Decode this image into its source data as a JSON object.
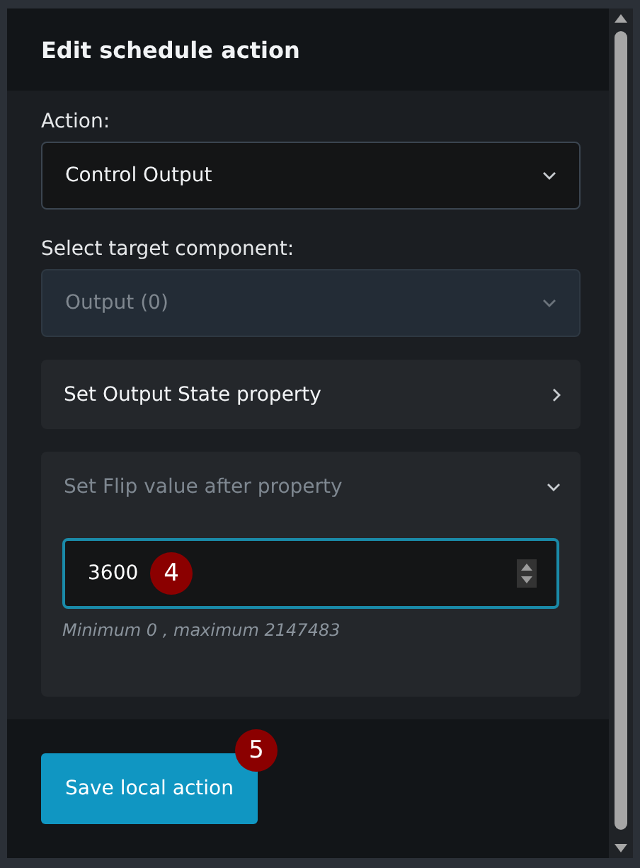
{
  "dialog": {
    "title": "Edit schedule action"
  },
  "fields": [
    {
      "label": "Action:",
      "value": "Control Output",
      "disabled": false
    },
    {
      "label": "Select target component:",
      "value": "Output (0)",
      "disabled": true
    }
  ],
  "sections": [
    {
      "title": "Set Output State property",
      "expanded": false
    },
    {
      "title": "Set Flip value after property",
      "expanded": true,
      "input": {
        "value": "3600",
        "hint": "Minimum 0 , maximum 2147483"
      }
    }
  ],
  "save_button": {
    "label": "Save local action"
  },
  "markers": [
    {
      "label": "4"
    },
    {
      "label": "5"
    }
  ]
}
